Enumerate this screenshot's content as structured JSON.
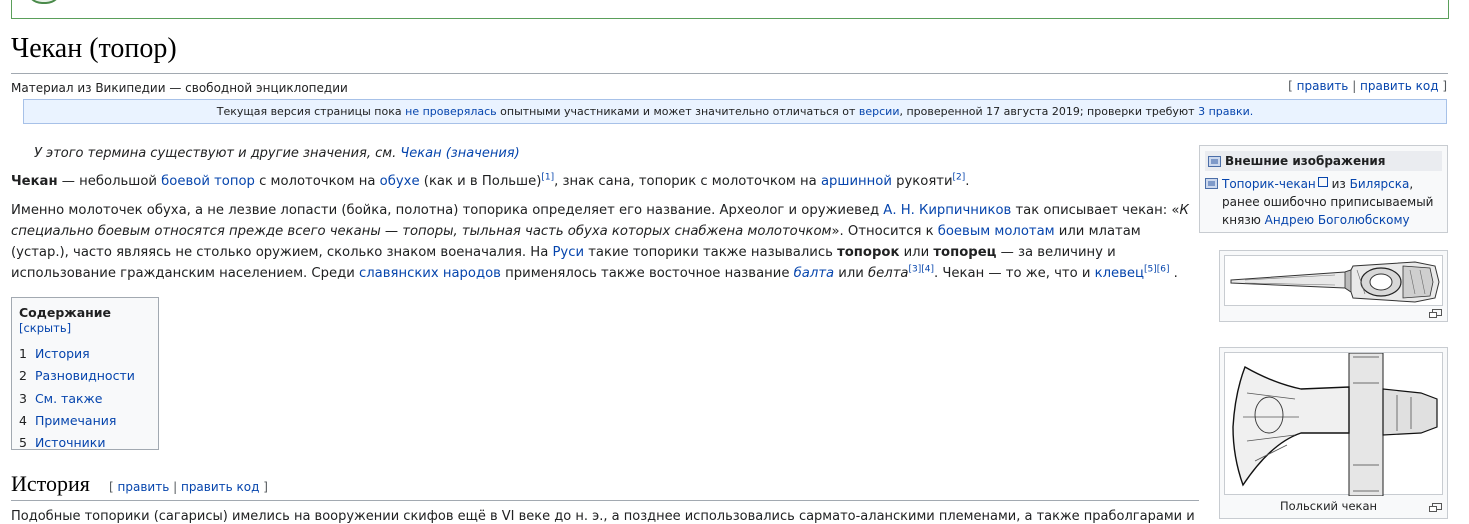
{
  "page": {
    "title": "Чекан (топор)",
    "tagline": "Материал из Википедии — свободной энциклопедии",
    "edit": "править",
    "edit_code": "править код"
  },
  "flagged": {
    "pre": "Текущая версия страницы пока",
    "link1": "не проверялась",
    "mid": "опытными участниками и может значительно отличаться от",
    "link2": "версии",
    "post": ", проверенной 17 августа 2019; проверки требуют",
    "link3": "3 правки."
  },
  "hatnote": {
    "text": "У этого термина существуют и другие значения, см.",
    "link": "Чекан (значения)"
  },
  "intro": {
    "p1": [
      {
        "t": "Чекан",
        "b": true
      },
      {
        "t": " — небольшой "
      },
      {
        "t": "боевой топор",
        "l": true
      },
      {
        "t": " с молоточком на "
      },
      {
        "t": "обухе",
        "l": true
      },
      {
        "t": " (как и в Польше)"
      },
      {
        "t": "[1]",
        "sup": true
      },
      {
        "t": ", знак сана, топорик с молоточком на "
      },
      {
        "t": "аршинной",
        "l": true
      },
      {
        "t": " рукояти"
      },
      {
        "t": "[2]",
        "sup": true
      },
      {
        "t": "."
      }
    ],
    "p2": [
      {
        "t": "Именно молоточек обуха, а не лезвие лопасти (бойка, полотна) топорика определяет его название. Археолог и оружиевед "
      },
      {
        "t": "А. Н. Кирпичников",
        "l": true
      },
      {
        "t": " так описывает чекан: «"
      },
      {
        "t": "К специально боевым относятся прежде всего чеканы — топоры, тыльная часть обуха которых снабжена молоточком",
        "i": true
      },
      {
        "t": "». Относится к "
      },
      {
        "t": "боевым молотам",
        "l": true
      },
      {
        "t": " или млатам (устар.), часто являясь не столько оружием, сколько знаком военачалия. На "
      },
      {
        "t": "Руси",
        "l": true
      },
      {
        "t": " такие топорики также назывались "
      },
      {
        "t": "топорок",
        "b": true
      },
      {
        "t": " или "
      },
      {
        "t": "топорец",
        "b": true
      },
      {
        "t": " — за величину и использование гражданским населением. Среди "
      },
      {
        "t": "славянских народов",
        "l": true
      },
      {
        "t": " применялось также восточное название "
      },
      {
        "t": "балта",
        "l": true,
        "i": true
      },
      {
        "t": " или "
      },
      {
        "t": "белта",
        "i": true
      },
      {
        "t": "[3][4]",
        "sup": true
      },
      {
        "t": ". Чекан — то же, что и "
      },
      {
        "t": "клевец",
        "l": true
      },
      {
        "t": "[5][6]",
        "sup": true
      },
      {
        "t": " ."
      }
    ]
  },
  "toc": {
    "title": "Содержание",
    "toggle": "[скрыть]",
    "items": [
      {
        "num": "1",
        "label": "История"
      },
      {
        "num": "2",
        "label": "Разновидности"
      },
      {
        "num": "3",
        "label": "См. также"
      },
      {
        "num": "4",
        "label": "Примечания"
      },
      {
        "num": "5",
        "label": "Источники"
      }
    ]
  },
  "history": {
    "heading": "История",
    "edit_open": "[",
    "edit": "править",
    "sep": "|",
    "edit_code": "править код",
    "edit_close": "]",
    "text": "Подобные топорики (сагарисы) имелись на вооружении скифов ещё в VI веке до н. э., а позднее использовались сармато-аланскими племенами, а также праболгарами и хазарами"
  },
  "external_images": {
    "title": "Внешние изображения",
    "link": "Топорик-чекан",
    "from": " из ",
    "place": "Билярска",
    "text": ", ранее ошибочно приписываемый князю ",
    "person": "Андрею Боголюбскому"
  },
  "thumbs": [
    {
      "caption": ""
    },
    {
      "caption": "Польский чекан"
    }
  ],
  "colors": {
    "link": "#0645ad",
    "flagged_bg": "#eaf3ff",
    "panel_bg": "#f8f9fa"
  }
}
